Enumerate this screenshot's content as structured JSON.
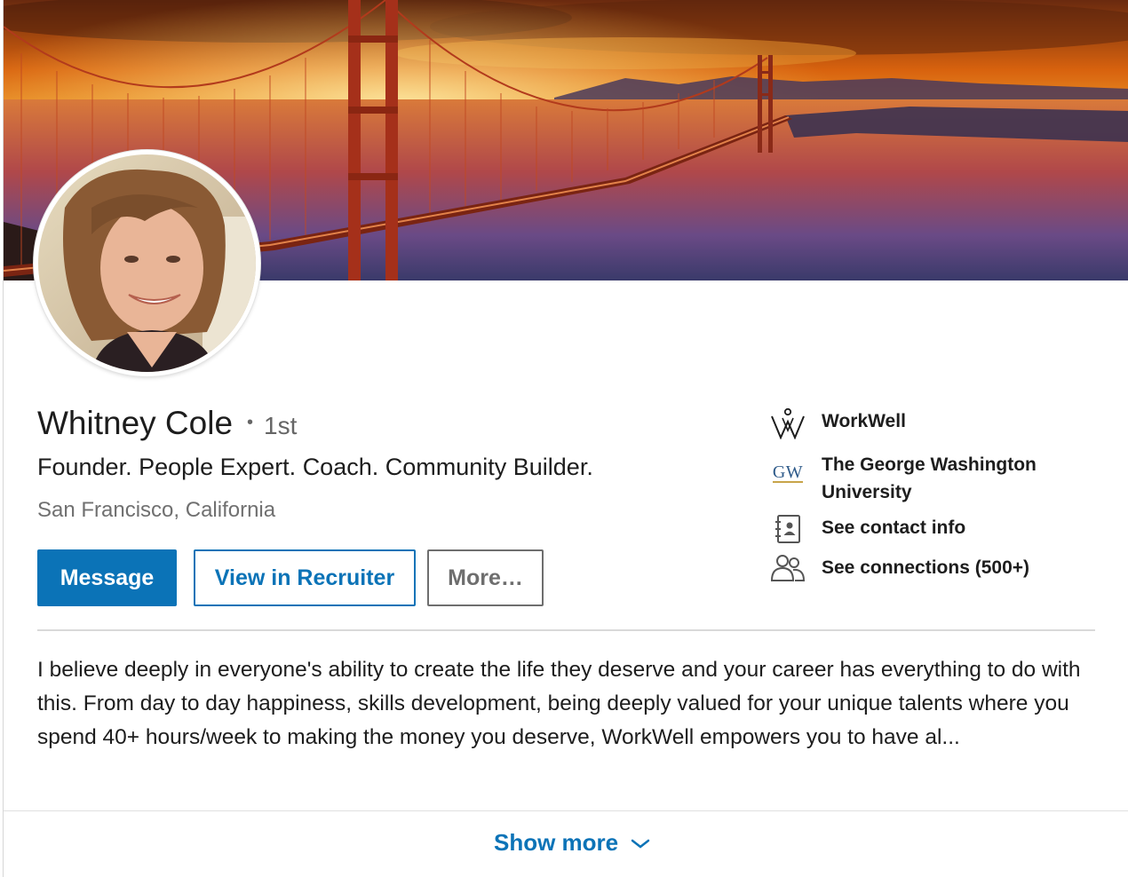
{
  "profile": {
    "name": "Whitney Cole",
    "separator": "•",
    "degree": "1st",
    "headline": "Founder. People Expert. Coach. Community Builder.",
    "location": "San Francisco, California"
  },
  "actions": {
    "message": "Message",
    "recruiter": "View in Recruiter",
    "more": "More…"
  },
  "sidebar": {
    "company": "WorkWell",
    "school": "The George Washington University",
    "school_logo_text": "GW",
    "contact": "See contact info",
    "connections": "See connections (500+)"
  },
  "summary": {
    "text": "I believe deeply in everyone's ability to create the life they deserve and your career has everything to do with this. From day to day happiness, skills development, being deeply valued for your unique talents where you spend 40+ hours/week to making the money you deserve, WorkWell empowers you to have al..."
  },
  "show_more": {
    "label": "Show more"
  },
  "colors": {
    "brand_blue": "#0b73b7",
    "text_primary": "#1d1d1d",
    "text_secondary": "#707070"
  }
}
